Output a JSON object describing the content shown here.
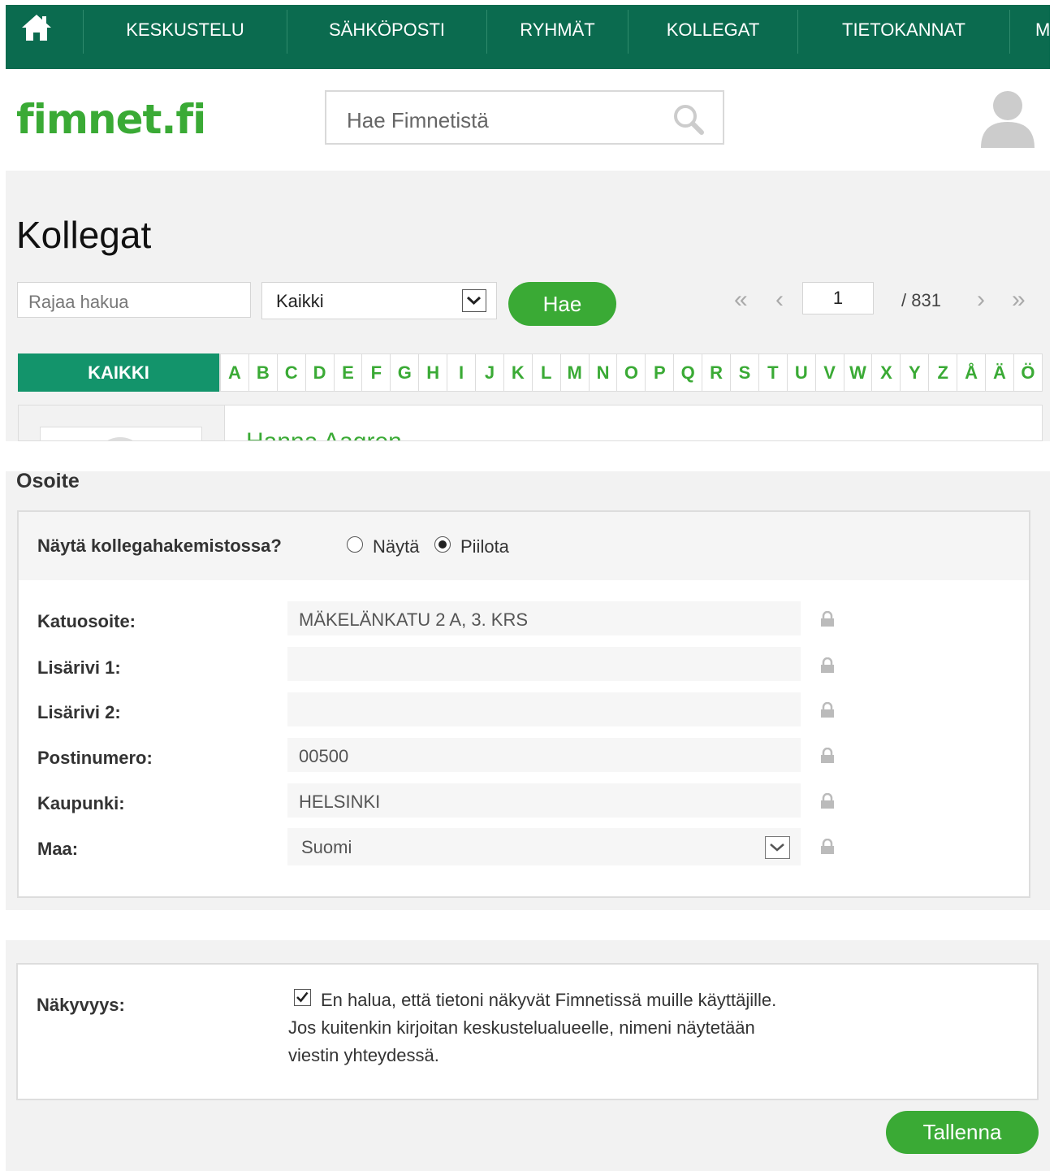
{
  "nav": {
    "items": [
      "KESKUSTELU",
      "SÄHKÖPOSTI",
      "RYHMÄT",
      "KOLLEGAT",
      "TIETOKANNAT",
      "M"
    ]
  },
  "header": {
    "logo": "fimnet.fi",
    "search_placeholder": "Hae Fimnetistä"
  },
  "page": {
    "title": "Kollegat",
    "filter_placeholder": "Rajaa hakua",
    "filter_select": "Kaikki",
    "search_button": "Hae",
    "current_page": "1",
    "total_pages": "/ 831",
    "all_tab": "KAIKKI",
    "letters": [
      "A",
      "B",
      "C",
      "D",
      "E",
      "F",
      "G",
      "H",
      "I",
      "J",
      "K",
      "L",
      "M",
      "N",
      "O",
      "P",
      "Q",
      "R",
      "S",
      "T",
      "U",
      "V",
      "W",
      "X",
      "Y",
      "Z",
      "Å",
      "Ä",
      "Ö"
    ],
    "first_result_name": "Hanna Aagren"
  },
  "address": {
    "title": "Osoite",
    "visibility_question": "Näytä kollegahakemistossa?",
    "option_show": "Näytä",
    "option_hide": "Piilota",
    "selected_option": "Piilota",
    "fields": [
      {
        "label": "Katuosoite:",
        "value": "MÄKELÄNKATU 2 A, 3. KRS"
      },
      {
        "label": "Lisärivi 1:",
        "value": ""
      },
      {
        "label": "Lisärivi 2:",
        "value": ""
      },
      {
        "label": "Postinumero:",
        "value": "00500"
      },
      {
        "label": "Kaupunki:",
        "value": "HELSINKI"
      },
      {
        "label": "Maa:",
        "value": "Suomi"
      }
    ]
  },
  "visibility": {
    "label": "Näkyvyys:",
    "checked": true,
    "text": "En halua, että tietoni näkyvät Fimnetissä muille käyttäjille. Jos kuitenkin kirjoitan keskustelualueelle, nimeni näytetään viestin yhteydessä."
  },
  "save_button": "Tallenna",
  "colors": {
    "nav_bg": "#0b6b4f",
    "brand_green": "#3aaa35",
    "tab_green": "#13946b",
    "panel_gray": "#f2f2f2"
  }
}
